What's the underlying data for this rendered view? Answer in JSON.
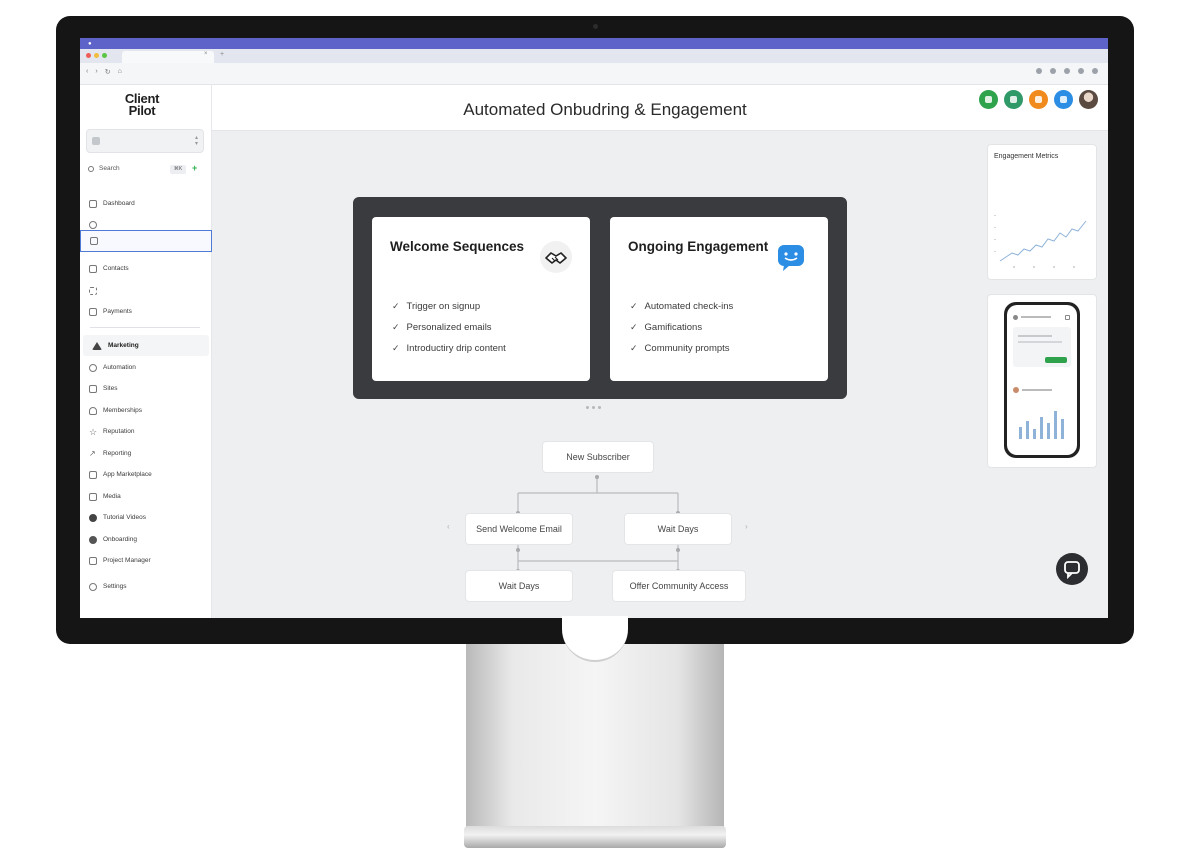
{
  "os": {
    "menu_items": [
      "",
      "",
      "",
      "",
      "",
      "",
      "",
      "",
      "",
      "",
      ""
    ]
  },
  "browser": {
    "tab_title": "",
    "url": ""
  },
  "sidebar": {
    "logo": "Client Pilot",
    "account": {
      "name": "",
      "subtitle": ""
    },
    "search_label": "Search",
    "search_shortcut": "⌘K",
    "items": [
      {
        "label": "Dashboard",
        "icon": "grid-icon"
      },
      {
        "label": "",
        "icon": "chat-icon"
      },
      {
        "label": "",
        "icon": "calendar-icon"
      },
      {
        "label": "Contacts",
        "icon": "contacts-icon"
      },
      {
        "label": "",
        "icon": "filter-icon"
      },
      {
        "label": "Payments",
        "icon": "wallet-icon"
      },
      {
        "label": "Marketing",
        "icon": "send-icon"
      },
      {
        "label": "Automation",
        "icon": "automation-icon"
      },
      {
        "label": "Sites",
        "icon": "sites-icon"
      },
      {
        "label": "Memberships",
        "icon": "membership-icon"
      },
      {
        "label": "Reputation",
        "icon": "star-icon"
      },
      {
        "label": "Reporting",
        "icon": "chart-icon"
      },
      {
        "label": "App Marketplace",
        "icon": "marketplace-icon"
      },
      {
        "label": "Media",
        "icon": "media-icon"
      },
      {
        "label": "Tutorial Videos",
        "icon": "play-icon"
      },
      {
        "label": "Onboarding",
        "icon": "onboarding-icon"
      },
      {
        "label": "Project Manager",
        "icon": "project-icon"
      },
      {
        "label": "Settings",
        "icon": "gear-icon"
      }
    ]
  },
  "header": {
    "title": "Automated Onbudring & Engagement",
    "actions": [
      {
        "icon": "edit-icon",
        "color": "#2fa24c"
      },
      {
        "icon": "calendar-icon",
        "color": "#2f9a68"
      },
      {
        "icon": "notification-icon",
        "color": "#f08a1c"
      },
      {
        "icon": "help-icon",
        "color": "#2b8de3"
      },
      {
        "icon": "user-avatar",
        "color": "#6b5a4e"
      }
    ]
  },
  "intro": {
    "text": "",
    "link": ""
  },
  "cards": [
    {
      "title": "Welcome Sequences",
      "description": "",
      "icon": "handshake-icon",
      "items": [
        "Trigger on signup",
        "Personalized emails",
        "Introductiry drip content"
      ]
    },
    {
      "title": "Ongoing Engagement",
      "description": "",
      "icon": "chat-bubble-icon",
      "items": [
        "Automated check-ins",
        "Gamifications",
        "Community prompts"
      ]
    }
  ],
  "flow": {
    "start": "New Subscriber",
    "nodes": [
      "Send Welcome Email",
      "Wait Days",
      "Wait Days",
      "Offer Community Access"
    ]
  },
  "metrics": {
    "title": "Engagement Metrics",
    "subtitle": "",
    "chart_label": ""
  },
  "colors": {
    "accent_blue": "#3a7bd5",
    "dark_panel": "#3a3b3e",
    "chat_blue": "#2b8de3",
    "chart_line": "#8fb3d8"
  }
}
